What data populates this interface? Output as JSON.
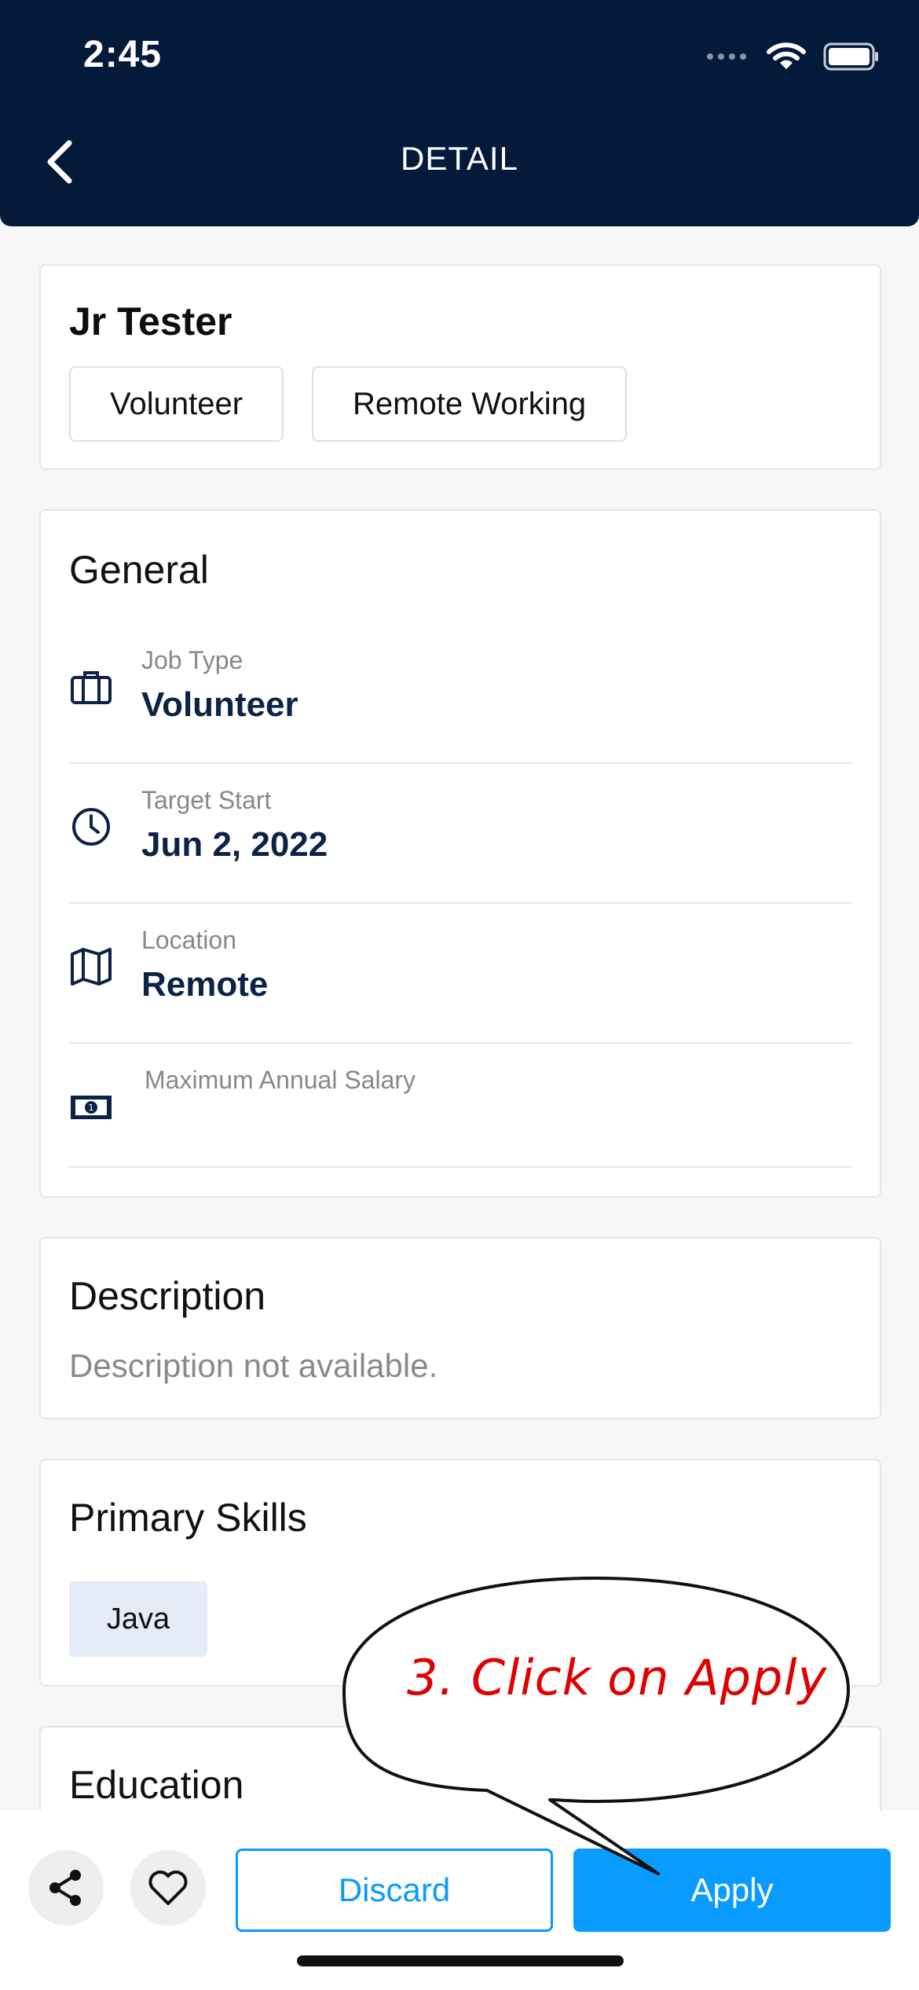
{
  "status_bar": {
    "time": "2:45"
  },
  "header": {
    "title": "DETAIL"
  },
  "job": {
    "title": "Jr Tester",
    "tags": [
      "Volunteer",
      "Remote Working"
    ]
  },
  "general": {
    "title": "General",
    "rows": [
      {
        "label": "Job Type",
        "value": "Volunteer",
        "icon": "briefcase-icon"
      },
      {
        "label": "Target Start",
        "value": "Jun 2, 2022",
        "icon": "clock-icon"
      },
      {
        "label": "Location",
        "value": "Remote",
        "icon": "map-icon"
      },
      {
        "label": "Maximum Annual Salary",
        "value": "",
        "icon": "money-icon"
      }
    ]
  },
  "description": {
    "title": "Description",
    "text": "Description not available."
  },
  "primary_skills": {
    "title": "Primary Skills",
    "skills": [
      "Java"
    ]
  },
  "education": {
    "title": "Education"
  },
  "actions": {
    "discard_label": "Discard",
    "apply_label": "Apply"
  },
  "annotation": {
    "text": "3. Click on Apply",
    "color": "#e00000"
  },
  "colors": {
    "header_bg": "#031a3a",
    "accent": "#0a9bff",
    "value_text": "#0c2346",
    "skill_bg": "#e5ecf7"
  }
}
